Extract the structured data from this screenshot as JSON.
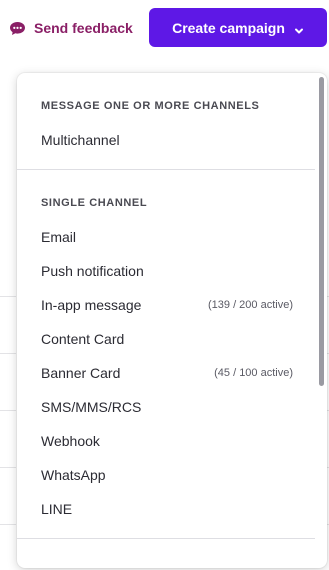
{
  "header": {
    "feedback_label": "Send feedback",
    "create_campaign_label": "Create campaign",
    "accent_color": "#5e18e6",
    "feedback_color": "#8a1f66"
  },
  "menu": {
    "multichannel_heading": "MESSAGE ONE OR MORE CHANNELS",
    "multichannel_item": "Multichannel",
    "single_heading": "SINGLE CHANNEL",
    "items": [
      {
        "label": "Email",
        "count": ""
      },
      {
        "label": "Push notification",
        "count": ""
      },
      {
        "label": "In-app message",
        "count": "(139 / 200 active)"
      },
      {
        "label": "Content Card",
        "count": ""
      },
      {
        "label": "Banner Card",
        "count": "(45 / 100 active)"
      },
      {
        "label": "SMS/MMS/RCS",
        "count": ""
      },
      {
        "label": "Webhook",
        "count": ""
      },
      {
        "label": "WhatsApp",
        "count": ""
      },
      {
        "label": "LINE",
        "count": ""
      }
    ]
  },
  "icons": {
    "feedback": "chat-bubble-icon",
    "create_campaign": "chevron-down-icon"
  }
}
